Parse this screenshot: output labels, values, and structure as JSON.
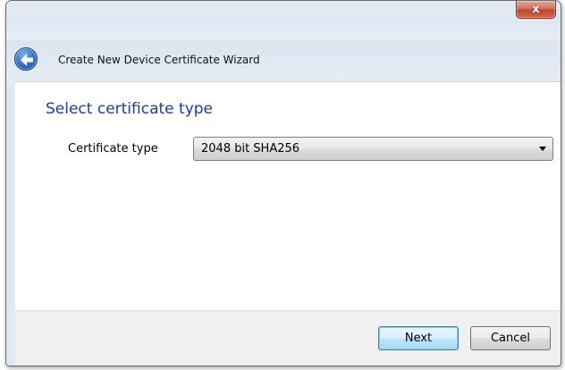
{
  "window": {
    "title": "Create New Device Certificate Wizard",
    "close_glyph": "x"
  },
  "page": {
    "heading": "Select certificate type"
  },
  "form": {
    "certificate_type_label": "Certificate type",
    "certificate_type_value": "2048 bit SHA256"
  },
  "footer": {
    "next_label": "Next",
    "cancel_label": "Cancel"
  },
  "icons": {
    "back": "back-arrow-icon",
    "close": "close-icon",
    "dropdown": "chevron-down-icon"
  },
  "colors": {
    "heading": "#1e3a9e",
    "close_button": "#c0452a",
    "default_button_border": "#3c7fb1"
  }
}
